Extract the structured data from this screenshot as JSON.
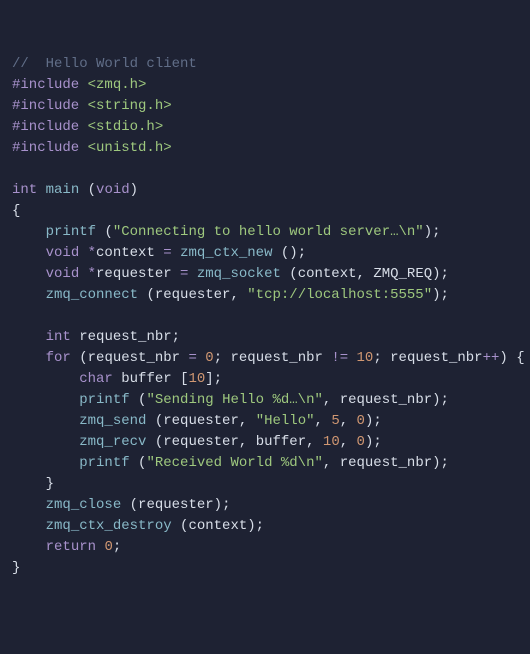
{
  "comment": "//  Hello World client",
  "inc": "#include",
  "hdr1": "<zmq.h>",
  "hdr2": "<string.h>",
  "hdr3": "<stdio.h>",
  "hdr4": "<unistd.h>",
  "kw_int": "int",
  "fn_main": "main",
  "kw_void": "void",
  "lbrace": "{",
  "rbrace": "}",
  "printf": "printf",
  "str_conn": "\"Connecting to hello world server…\\n\"",
  "context": "context",
  "zmq_ctx_new": "zmq_ctx_new",
  "requester": "requester",
  "zmq_socket": "zmq_socket",
  "zmq_req": "ZMQ_REQ",
  "zmq_connect": "zmq_connect",
  "str_tcp": "\"tcp://localhost:5555\"",
  "request_nbr": "request_nbr",
  "kw_for": "for",
  "kw_char": "char",
  "buffer": "buffer",
  "str_send": "\"Sending Hello %d…\\n\"",
  "zmq_send": "zmq_send",
  "str_hello": "\"Hello\"",
  "zmq_recv": "zmq_recv",
  "str_recv": "\"Received World %d\\n\"",
  "zmq_close": "zmq_close",
  "zmq_ctx_destroy": "zmq_ctx_destroy",
  "kw_return": "return",
  "n0": "0",
  "n5": "5",
  "n10": "10",
  "eq": " = ",
  "neq": " != ",
  "pp": "++",
  "star": "*",
  "semi": ";",
  "lp": "(",
  "rp": ")",
  "lb": "[",
  "rb": "]",
  "c": ", ",
  "sp": " "
}
